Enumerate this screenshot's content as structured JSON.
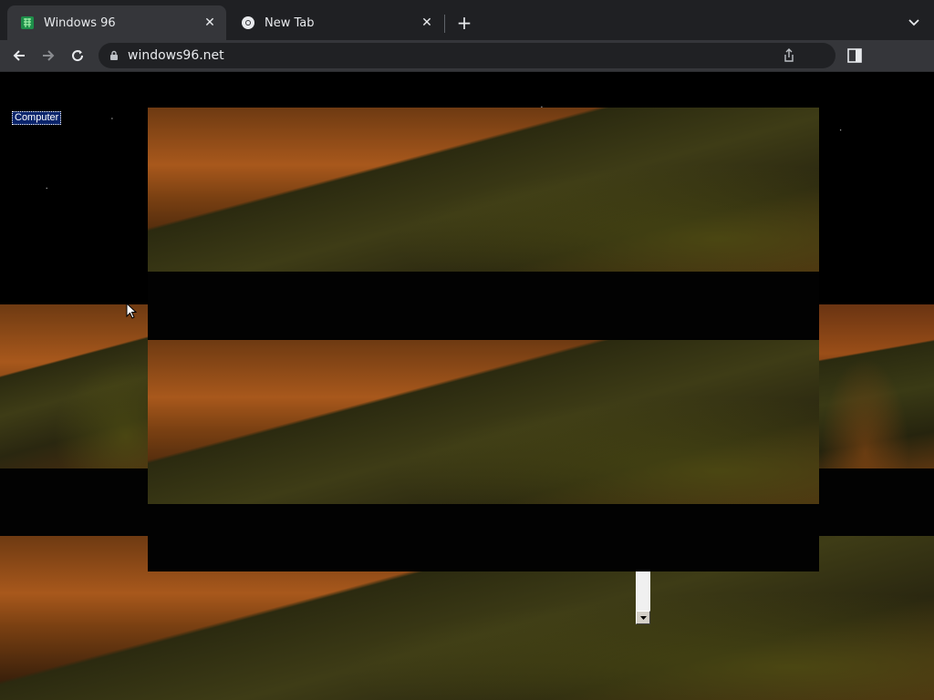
{
  "browser": {
    "tabs": [
      {
        "title": "Windows 96",
        "icon": "windows96-favicon",
        "active": true
      },
      {
        "title": "New Tab",
        "icon": "chrome-favicon",
        "active": false
      }
    ],
    "address": "windows96.net"
  },
  "desktop": {
    "icons": [
      {
        "label": "Computer"
      }
    ]
  },
  "colors": {
    "chrome_dark": "#1f2023",
    "chrome_tab": "#35363a",
    "selection": "#0a246a"
  }
}
